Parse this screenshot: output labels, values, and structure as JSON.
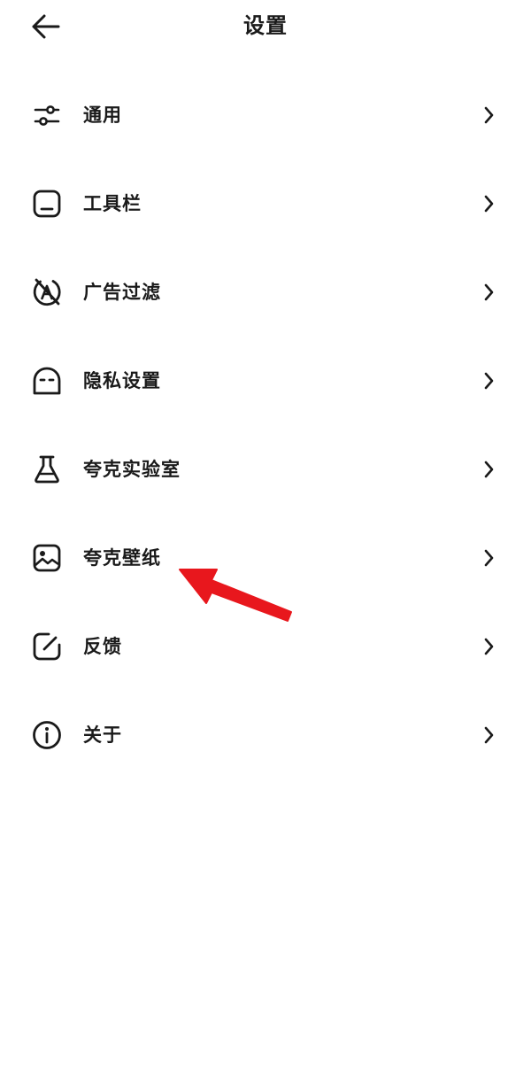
{
  "header": {
    "title": "设置",
    "back_icon": "arrow-left-icon"
  },
  "menu": {
    "items": [
      {
        "label": "通用",
        "icon": "sliders-icon"
      },
      {
        "label": "工具栏",
        "icon": "toolbar-icon"
      },
      {
        "label": "广告过滤",
        "icon": "ad-block-icon"
      },
      {
        "label": "隐私设置",
        "icon": "privacy-face-icon"
      },
      {
        "label": "夸克实验室",
        "icon": "flask-icon"
      },
      {
        "label": "夸克壁纸",
        "icon": "image-icon"
      },
      {
        "label": "反馈",
        "icon": "edit-icon"
      },
      {
        "label": "关于",
        "icon": "info-icon"
      }
    ],
    "chevron_icon": "chevron-right-icon"
  },
  "annotation": {
    "arrow_color": "#e8171d",
    "points_to": "夸克壁纸"
  }
}
